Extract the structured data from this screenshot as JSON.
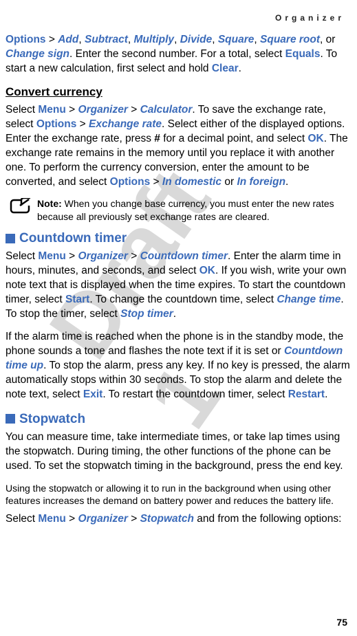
{
  "header": "Organizer",
  "watermark": "Draft 1",
  "page_number": "75",
  "intro": {
    "options": "Options",
    "add": "Add",
    "subtract": "Subtract",
    "multiply": "Multiply",
    "divide": "Divide",
    "square": "Square",
    "square_root": "Square root",
    "change_sign": "Change sign",
    "equals": "Equals",
    "clear": "Clear",
    "t1": " > ",
    "t2": ", ",
    "t3": ", or ",
    "t4": ". Enter the second number. For a total, select ",
    "t5": ". To start a new calculation, first select and hold ",
    "t6": "."
  },
  "convert": {
    "heading": "Convert currency",
    "menu": "Menu",
    "organizer": "Organizer",
    "calculator": "Calculator",
    "options": "Options",
    "exchange_rate": "Exchange rate",
    "ok": "OK",
    "options2": "Options",
    "in_domestic": "In domestic",
    "in_foreign": "In foreign",
    "t0": "Select ",
    "t1": " > ",
    "t2": ". To save the exchange rate, select ",
    "t3": ". Select either of the displayed options. Enter the exchange rate, press ",
    "hash": "#",
    "t4": " for a decimal point, and select ",
    "t5": ". The exchange rate remains in the memory until you replace it with another one. To perform the currency conversion, enter the amount to be converted, and select ",
    "t6": " or ",
    "t7": "."
  },
  "note": {
    "label": "Note:",
    "text": " When you change base currency, you must enter the new rates because all previously set exchange rates are cleared."
  },
  "countdown": {
    "heading": "Countdown timer",
    "menu": "Menu",
    "organizer": "Organizer",
    "countdown_timer": "Countdown timer",
    "ok": "OK",
    "start": "Start",
    "change_time": "Change time",
    "stop_timer": "Stop timer",
    "t0": "Select ",
    "t1": " > ",
    "t2": ". Enter the alarm time in hours, minutes, and seconds, and select ",
    "t3": ". If you wish, write your own note text that is displayed when the time expires. To start the countdown timer, select ",
    "t4": ". To change the countdown time, select ",
    "t5": ". To stop the timer, select ",
    "t6": ".",
    "p2_t1": "If the alarm time is reached when the phone is in the standby mode, the phone sounds a tone and flashes the note text if it is set or ",
    "countdown_time_up": "Countdown time up",
    "p2_t2": ". To stop the alarm, press any key. If no key is pressed, the alarm automatically stops within 30 seconds. To stop the alarm and delete the note text, select ",
    "exit": "Exit",
    "p2_t3": ". To restart the countdown timer, select ",
    "restart": "Restart",
    "p2_t4": "."
  },
  "stopwatch": {
    "heading": "Stopwatch",
    "p1": "You can measure time, take intermediate times, or take lap times using the stopwatch. During timing, the other functions of the phone can be used. To set the stopwatch timing in the background, press the end key.",
    "p2": "Using the stopwatch or allowing it to run in the background when using other features increases the demand on battery power and reduces the battery life.",
    "menu": "Menu",
    "organizer": "Organizer",
    "stopwatch_link": "Stopwatch",
    "t0": "Select ",
    "t1": " > ",
    "t2": " and from the following options:"
  }
}
